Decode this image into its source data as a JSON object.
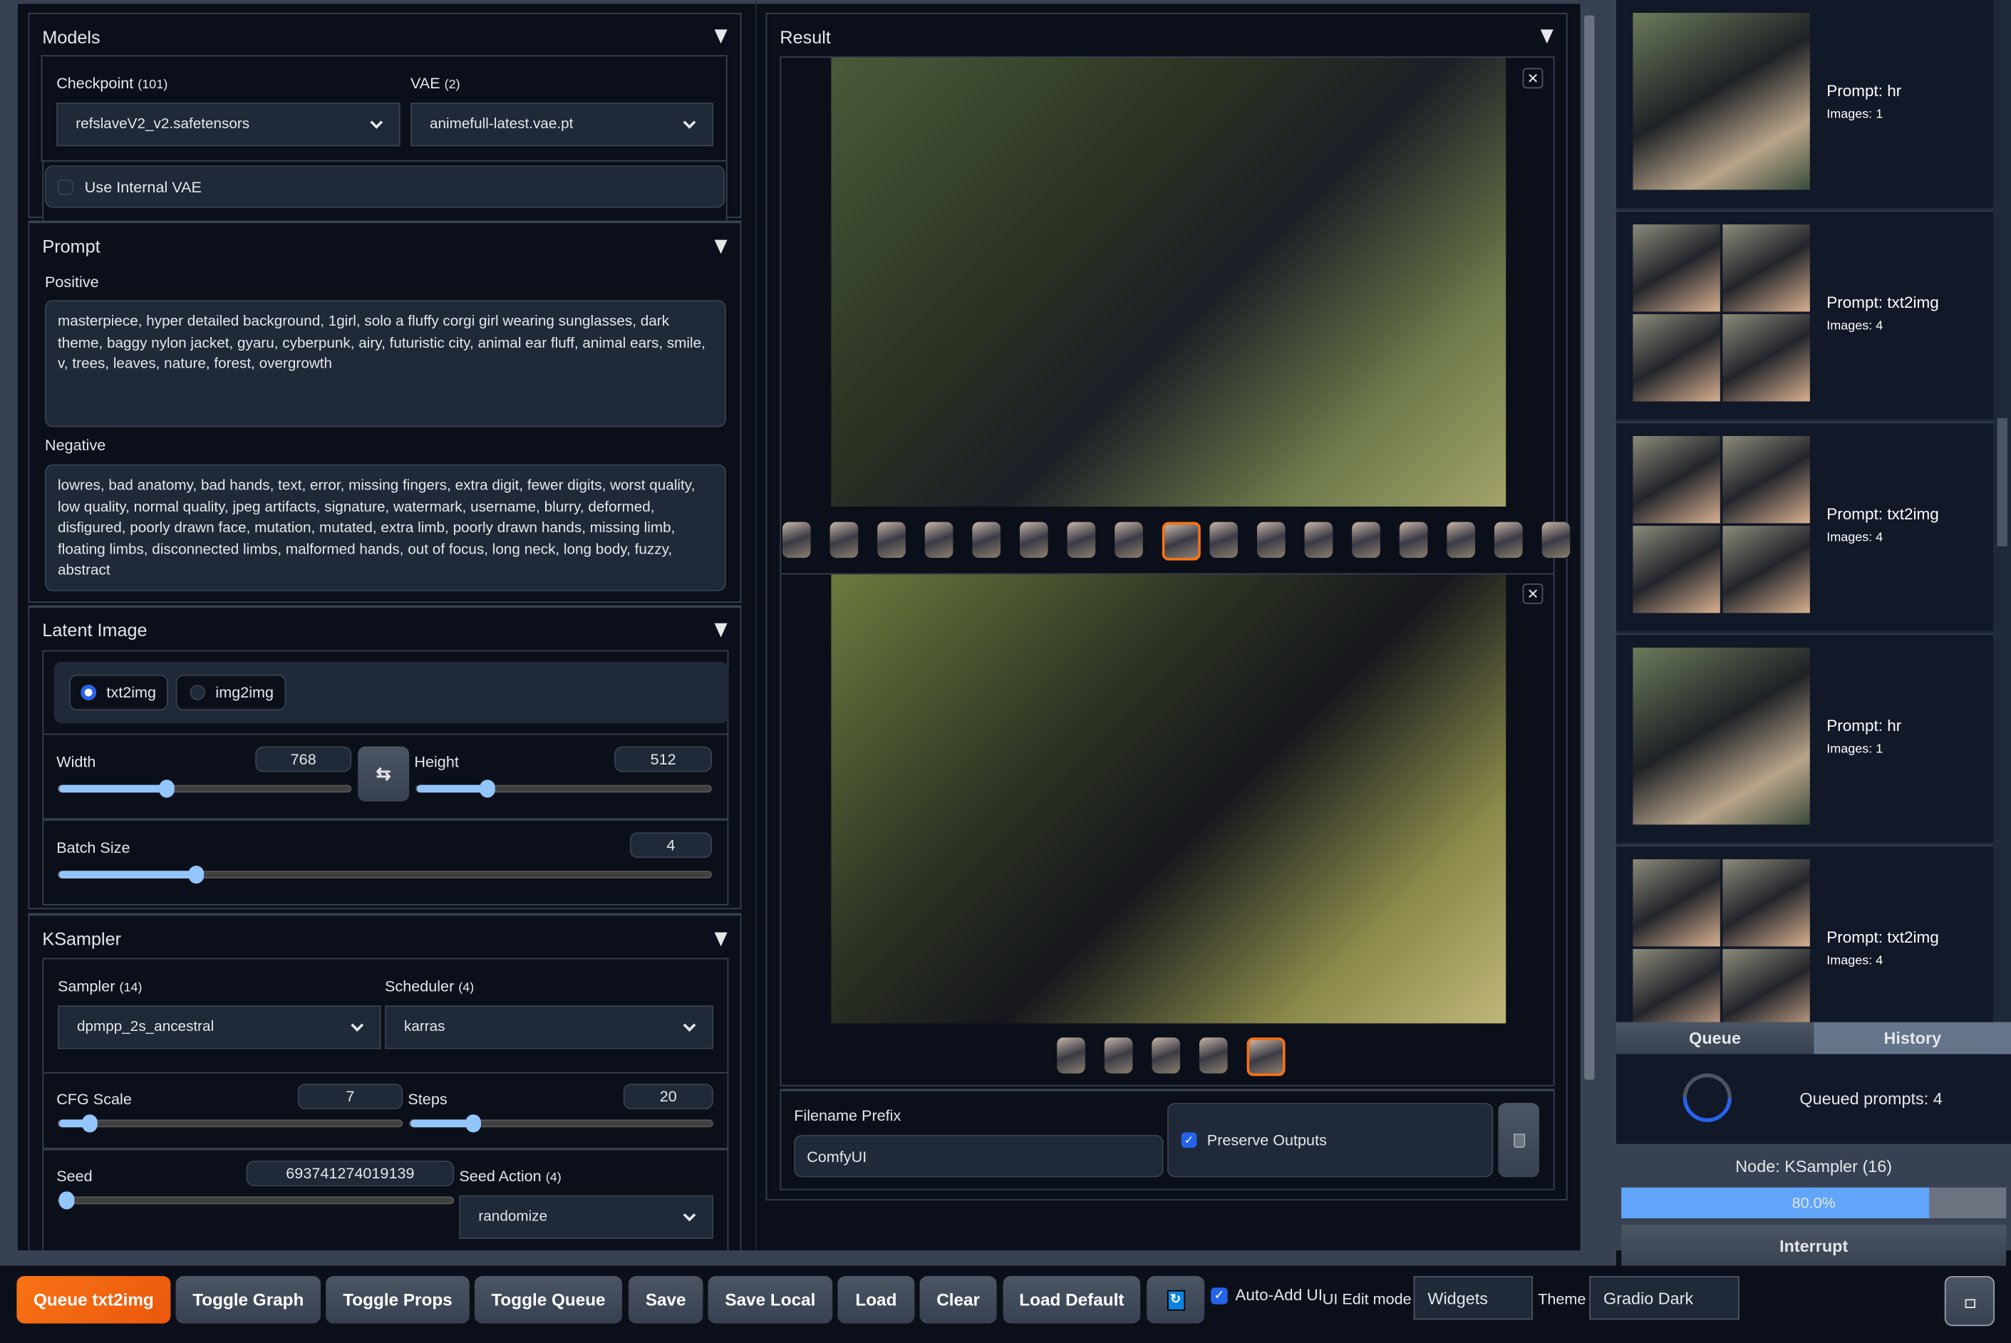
{
  "models": {
    "title": "Models",
    "checkpoint_label": "Checkpoint",
    "checkpoint_count": "(101)",
    "checkpoint_value": "refslaveV2_v2.safetensors",
    "vae_label": "VAE",
    "vae_count": "(2)",
    "vae_value": "animefull-latest.vae.pt",
    "use_internal_vae": "Use Internal VAE",
    "use_internal_vae_checked": false
  },
  "prompt": {
    "title": "Prompt",
    "positive_label": "Positive",
    "positive": "masterpiece, hyper detailed background, 1girl, solo a fluffy corgi girl wearing sunglasses, dark theme, baggy nylon jacket, gyaru, cyberpunk, airy, futuristic city, animal ear fluff, animal ears, smile, v, trees, leaves, nature, forest, overgrowth",
    "negative_label": "Negative",
    "negative": "lowres, bad anatomy, bad hands, text, error, missing fingers, extra digit, fewer digits, worst quality, low quality, normal quality, jpeg artifacts, signature, watermark, username, blurry, deformed, disfigured, poorly drawn face, mutation, mutated, extra limb, poorly drawn hands, missing limb, floating limbs, disconnected limbs, malformed hands, out of focus, long neck, long body, fuzzy, abstract"
  },
  "latent": {
    "title": "Latent Image",
    "modes": [
      "txt2img",
      "img2img"
    ],
    "selected_mode": "txt2img",
    "width_label": "Width",
    "width": "768",
    "width_fraction": 0.37,
    "height_label": "Height",
    "height": "512",
    "height_fraction": 0.24,
    "batch_label": "Batch Size",
    "batch": "4",
    "batch_fraction": 0.21
  },
  "ksampler": {
    "title": "KSampler",
    "sampler_label": "Sampler",
    "sampler_count": "(14)",
    "sampler_value": "dpmpp_2s_ancestral",
    "scheduler_label": "Scheduler",
    "scheduler_count": "(4)",
    "scheduler_value": "karras",
    "cfg_label": "CFG Scale",
    "cfg": "7",
    "cfg_fraction": 0.09,
    "steps_label": "Steps",
    "steps": "20",
    "steps_fraction": 0.21,
    "seed_label": "Seed",
    "seed": "693741274019139",
    "seed_fraction": 0.0,
    "seed_action_label": "Seed Action",
    "seed_action_count": "(4)",
    "seed_action_value": "randomize"
  },
  "result": {
    "title": "Result",
    "strip1_count": 17,
    "strip1_active": 8,
    "strip2_count": 5,
    "strip2_active": 4,
    "filename_label": "Filename Prefix",
    "filename_value": "ComfyUI",
    "preserve_label": "Preserve Outputs",
    "preserve_checked": true
  },
  "history": [
    {
      "prompt": "Prompt: hr",
      "images": "Images: 1"
    },
    {
      "prompt": "Prompt: txt2img",
      "images": "Images: 4"
    },
    {
      "prompt": "Prompt: txt2img",
      "images": "Images: 4"
    },
    {
      "prompt": "Prompt: hr",
      "images": "Images: 1"
    },
    {
      "prompt": "Prompt: txt2img",
      "images": "Images: 4"
    }
  ],
  "queue": {
    "tab_queue": "Queue",
    "tab_history": "History",
    "queued": "Queued prompts: 4",
    "node": "Node: KSampler (16)",
    "progress_text": "80.0%",
    "progress": 0.8,
    "interrupt": "Interrupt"
  },
  "toolbar": {
    "queue": "Queue txt2img",
    "toggle_graph": "Toggle Graph",
    "toggle_props": "Toggle Props",
    "toggle_queue": "Toggle Queue",
    "save": "Save",
    "save_local": "Save Local",
    "load": "Load",
    "clear": "Clear",
    "load_default": "Load Default",
    "auto_add": "Auto-Add UI",
    "auto_add_checked": true,
    "edit_mode_label": "UI Edit mode",
    "edit_mode_value": "Widgets",
    "theme_label": "Theme",
    "theme_value": "Gradio Dark"
  },
  "colors": {
    "accent": "#f97316",
    "slider": "#93c5fd",
    "progress": "#60a5fa",
    "checkbox": "#2563eb"
  }
}
